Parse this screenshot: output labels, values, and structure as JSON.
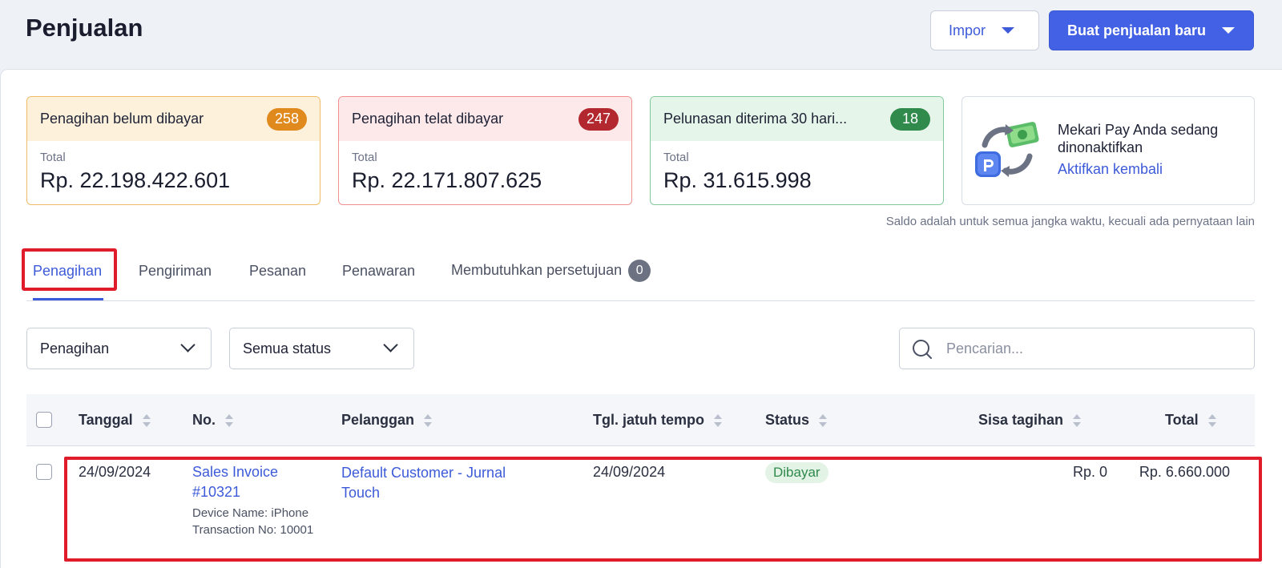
{
  "header": {
    "title": "Penjualan",
    "import_label": "Impor",
    "new_sale_label": "Buat penjualan baru"
  },
  "summary_cards": [
    {
      "title": "Penagihan belum dibayar",
      "count": "258",
      "total_label": "Total",
      "amount": "Rp. 22.198.422.601",
      "accent": "#e08a1e"
    },
    {
      "title": "Penagihan telat dibayar",
      "count": "247",
      "total_label": "Total",
      "amount": "Rp. 22.171.807.625",
      "accent": "#b2282e"
    },
    {
      "title": "Pelunasan diterima 30 hari...",
      "count": "18",
      "total_label": "Total",
      "amount": "Rp. 31.615.998",
      "accent": "#2f8a4c"
    }
  ],
  "mekari_pay": {
    "message": "Mekari Pay Anda sedang dinonaktifkan",
    "action_label": "Aktifkan kembali"
  },
  "saldo_note": "Saldo adalah untuk semua jangka waktu, kecuali ada pernyataan lain",
  "tabs": [
    {
      "label": "Penagihan",
      "active": true
    },
    {
      "label": "Pengiriman",
      "active": false
    },
    {
      "label": "Pesanan",
      "active": false
    },
    {
      "label": "Penawaran",
      "active": false
    },
    {
      "label": "Membutuhkan persetujuan",
      "count": "0",
      "active": false
    }
  ],
  "filters": {
    "type_value": "Penagihan",
    "status_value": "Semua status",
    "search_placeholder": "Pencarian..."
  },
  "table": {
    "columns": [
      "Tanggal",
      "No.",
      "Pelanggan",
      "Tgl. jatuh tempo",
      "Status",
      "Sisa tagihan",
      "Total"
    ],
    "rows": [
      {
        "date": "24/09/2024",
        "number": "Sales Invoice #10321",
        "note": "Device Name: iPhone Transaction No: 10001",
        "customer": "Default Customer - Jurnal Touch",
        "due_date": "24/09/2024",
        "status": "Dibayar",
        "remaining": "Rp. 0",
        "total": "Rp. 6.660.000"
      }
    ]
  },
  "colors": {
    "primary": "#4361e4",
    "link": "#3d5bd9",
    "highlight": "#e01b2a"
  }
}
